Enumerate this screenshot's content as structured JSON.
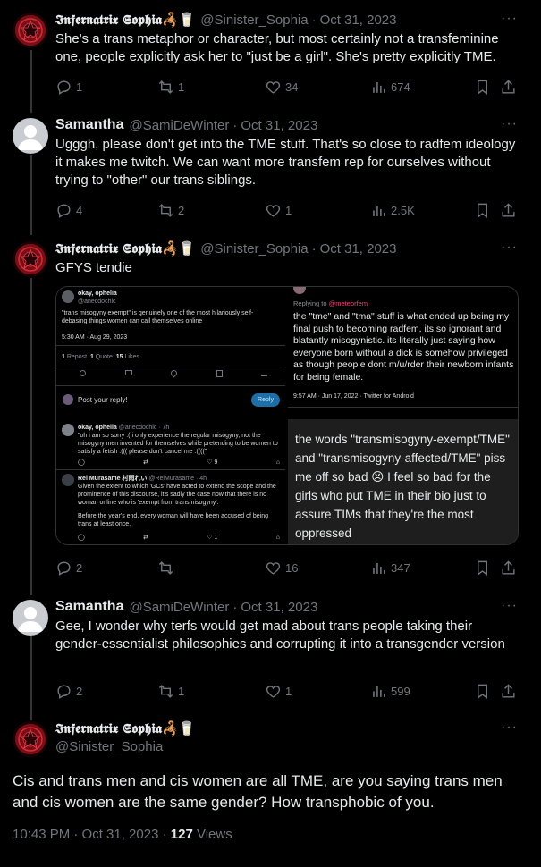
{
  "tweets": [
    {
      "name": "𝕴𝖓𝖋𝖊𝖗𝖓𝖆𝖙𝖗𝖎𝖝 𝕾𝖔𝖕𝖍𝖎𝖆🦂🥛",
      "handle": "@Sinister_Sophia",
      "date": "Oct 31, 2023",
      "text": "She's a trans metaphor or character, but most certainly not a transfeminine one, people explicitly ask her to \"just be a girl\". She's pretty explicitly TME.",
      "replies": "1",
      "reposts": "1",
      "likes": "34",
      "views": "674"
    },
    {
      "name": "Samantha",
      "handle": "@SamiDeWinter",
      "date": "Oct 31, 2023",
      "text": "Ugggh, please don't get into the TME stuff. That's so close to radfem ideology it makes me twitch. We can want more transfem rep for ourselves without trying to \"other\" our trans siblings.",
      "replies": "4",
      "reposts": "2",
      "likes": "1",
      "views": "2.5K"
    },
    {
      "name": "𝕴𝖓𝖋𝖊𝖗𝖓𝖆𝖙𝖗𝖎𝖝 𝕾𝖔𝖕𝖍𝖎𝖆🦂🥛",
      "handle": "@Sinister_Sophia",
      "date": "Oct 31, 2023",
      "text": "GFYS tendie",
      "replies": "2",
      "reposts": "",
      "likes": "16",
      "views": "347"
    },
    {
      "name": "Samantha",
      "handle": "@SamiDeWinter",
      "date": "Oct 31, 2023",
      "text": "Gee, I wonder why terfs would get mad about trans people taking their gender-essentialist philosophies and corrupting it into a transgender version",
      "replies": "2",
      "reposts": "1",
      "likes": "1",
      "views": "599"
    }
  ],
  "media": {
    "top_left": {
      "name": "okay, ophelia",
      "handle": "@anecdochic",
      "text": "\"trans misogyny exempt\" is genuinely one of the most hilariously self-debasing things women can call themselves online",
      "time": "5:30 AM · Aug 29, 2023",
      "repost_count": "1",
      "repost_label": "Repost",
      "quote_count": "1",
      "quote_label": "Quote",
      "like_count": "15",
      "like_label": "Likes",
      "reply_placeholder": "Post your reply!",
      "reply_button": "Reply"
    },
    "bottom_left": {
      "reply1_name": "okay, ophelia",
      "reply1_handle": "@anecdochic · 7h",
      "reply1_text": "\"oh i am so sorry :( i only experience the regular misogyny, not the misogyny men invented for themselves while pretending to be women to satisfy a fetish :((( please don't cancel me :((((\"",
      "reply1_like": "9",
      "reply2_name": "Rei Murasame 村雨れい",
      "reply2_handle": "@ReiMurasame · 4h",
      "reply2_text1": "Given the extent to which 'GCs' have acted to extend the scope and the prominence of this discourse, it's sadly the case now that there is no woman online who is 'exempt from transmisogyny'.",
      "reply2_text2": "Before the year's end, every woman will have been accused of being trans at least once.",
      "reply2_like": "1"
    },
    "top_right": {
      "replying_prefix": "Replying to",
      "replying_handle": "@meteorfem",
      "text": "the \"tme\" and \"tma\" stuff is what ended up being my final push to becoming radfem, its so ignorant and blatantly misogynistic. its literally just saying how everyone born without a dick is somehow privileged as though people dont m/u/rder their newborn infants for being female.",
      "time": "9:57 AM · Jun 17, 2022 · Twitter for Android"
    },
    "bottom_right": {
      "text": "the words \"transmisogyny-exempt/TME\" and \"transmisogyny-affected/TME\" piss me off so bad 😣 I feel so bad for the girls who put TME in their bio just to assure TIMs that they're the most oppressed"
    }
  },
  "main_tweet": {
    "name": "𝕴𝖓𝖋𝖊𝖗𝖓𝖆𝖙𝖗𝖎𝖝 𝕾𝖔𝖕𝖍𝖎𝖆🦂🥛",
    "handle": "@Sinister_Sophia",
    "text": "Cis and trans men and cis women are all TME, are you saying trans men and cis women are the same gender? How transphobic of you.",
    "time": "10:43 PM · Oct 31, 2023 ·",
    "views_count": "127",
    "views_label": "Views"
  },
  "more_label": "···",
  "dot": "·"
}
